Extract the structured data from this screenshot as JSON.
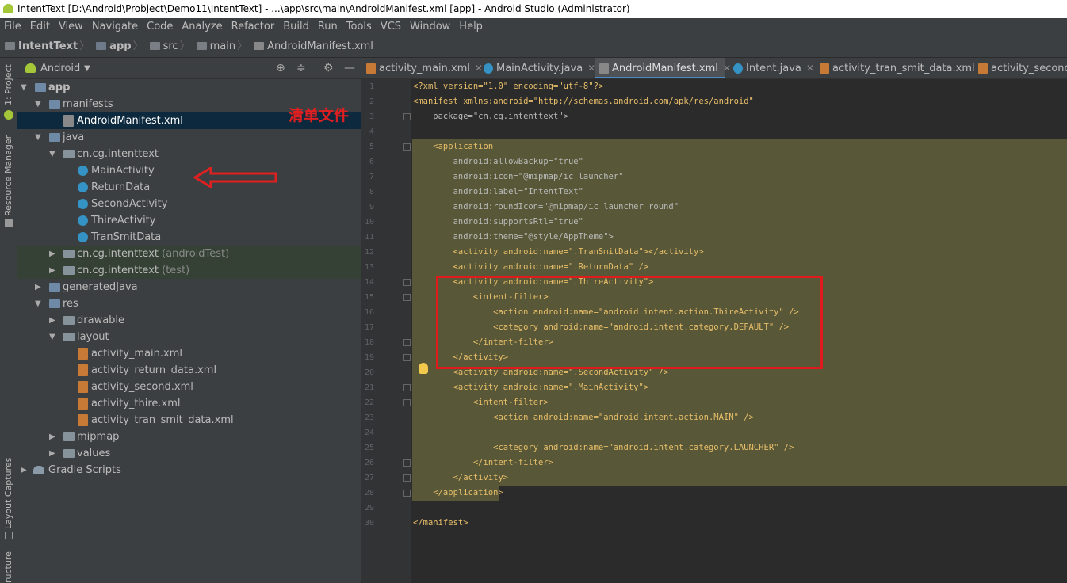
{
  "window": {
    "title": "IntentText [D:\\Android\\Probject\\Demo11\\IntentText] - ...\\app\\src\\main\\AndroidManifest.xml [app] - Android Studio (Administrator)"
  },
  "menu": [
    "File",
    "Edit",
    "View",
    "Navigate",
    "Code",
    "Analyze",
    "Refactor",
    "Build",
    "Run",
    "Tools",
    "VCS",
    "Window",
    "Help"
  ],
  "breadcrumb": [
    "IntentText",
    "app",
    "src",
    "main",
    "AndroidManifest.xml"
  ],
  "side_tabs": {
    "project": "1: Project",
    "resource_manager": "Resource Manager",
    "layout_captures": "Layout Captures",
    "structure": "ructure"
  },
  "project_panel": {
    "view_mode": "Android",
    "tree": [
      {
        "label": "app",
        "extra": "",
        "icon": "folder-icon"
      },
      {
        "label": "manifests",
        "extra": "",
        "icon": "folder-icon"
      },
      {
        "label": "AndroidManifest.xml",
        "extra": "",
        "icon": "manifest-file-icon"
      },
      {
        "label": "java",
        "extra": "",
        "icon": "folder-icon"
      },
      {
        "label": "cn.cg.intenttext",
        "extra": "",
        "icon": "package-icon"
      },
      {
        "label": "MainActivity",
        "extra": "",
        "icon": "class-icon"
      },
      {
        "label": "ReturnData",
        "extra": "",
        "icon": "class-icon"
      },
      {
        "label": "SecondActivity",
        "extra": "",
        "icon": "class-icon"
      },
      {
        "label": "ThireActivity",
        "extra": "",
        "icon": "class-icon"
      },
      {
        "label": "TranSmitData",
        "extra": "",
        "icon": "class-icon"
      },
      {
        "label": "cn.cg.intenttext",
        "extra": "(androidTest)",
        "icon": "package-icon"
      },
      {
        "label": "cn.cg.intenttext",
        "extra": "(test)",
        "icon": "package-icon"
      },
      {
        "label": "generatedJava",
        "extra": "",
        "icon": "folder-icon"
      },
      {
        "label": "res",
        "extra": "",
        "icon": "folder-icon"
      },
      {
        "label": "drawable",
        "extra": "",
        "icon": "folder-icon"
      },
      {
        "label": "layout",
        "extra": "",
        "icon": "folder-icon"
      },
      {
        "label": "activity_main.xml",
        "extra": "",
        "icon": "xml-file-icon"
      },
      {
        "label": "activity_return_data.xml",
        "extra": "",
        "icon": "xml-file-icon"
      },
      {
        "label": "activity_second.xml",
        "extra": "",
        "icon": "xml-file-icon"
      },
      {
        "label": "activity_thire.xml",
        "extra": "",
        "icon": "xml-file-icon"
      },
      {
        "label": "activity_tran_smit_data.xml",
        "extra": "",
        "icon": "xml-file-icon"
      },
      {
        "label": "mipmap",
        "extra": "",
        "icon": "folder-icon"
      },
      {
        "label": "values",
        "extra": "",
        "icon": "folder-icon"
      },
      {
        "label": "Gradle Scripts",
        "extra": "",
        "icon": "gradle-icon"
      }
    ],
    "annotation": "清单文件"
  },
  "editor_tabs": [
    "activity_main.xml",
    "MainActivity.java",
    "AndroidManifest.xml",
    "Intent.java",
    "activity_tran_smit_data.xml",
    "activity_second.xml"
  ],
  "active_tab": "AndroidManifest.xml",
  "code_lines": [
    "<?xml version=\"1.0\" encoding=\"utf-8\"?>",
    "<manifest xmlns:android=\"http://schemas.android.com/apk/res/android\"",
    "    package=\"cn.cg.intenttext\">",
    "",
    "    <application",
    "        android:allowBackup=\"true\"",
    "        android:icon=\"@mipmap/ic_launcher\"",
    "        android:label=\"IntentText\"",
    "        android:roundIcon=\"@mipmap/ic_launcher_round\"",
    "        android:supportsRtl=\"true\"",
    "        android:theme=\"@style/AppTheme\">",
    "        <activity android:name=\".TranSmitData\"></activity>",
    "        <activity android:name=\".ReturnData\" />",
    "        <activity android:name=\".ThireActivity\">",
    "            <intent-filter>",
    "                <action android:name=\"android.intent.action.ThireActivity\" />",
    "                <category android:name=\"android.intent.category.DEFAULT\" />",
    "            </intent-filter>",
    "        </activity>",
    "        <activity android:name=\".SecondActivity\" />",
    "        <activity android:name=\".MainActivity\">",
    "            <intent-filter>",
    "                <action android:name=\"android.intent.action.MAIN\" />",
    "",
    "                <category android:name=\"android.intent.category.LAUNCHER\" />",
    "            </intent-filter>",
    "        </activity>",
    "    </application>",
    "",
    "</manifest>"
  ]
}
